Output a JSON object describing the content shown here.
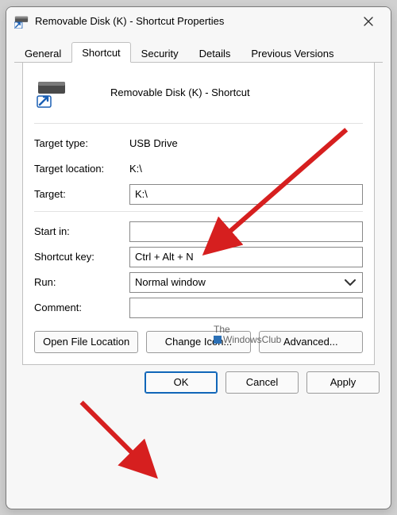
{
  "window": {
    "title": "Removable Disk (K) - Shortcut Properties"
  },
  "tabs": [
    {
      "label": "General"
    },
    {
      "label": "Shortcut"
    },
    {
      "label": "Security"
    },
    {
      "label": "Details"
    },
    {
      "label": "Previous Versions"
    }
  ],
  "header": {
    "name": "Removable Disk (K) - Shortcut"
  },
  "fields": {
    "target_type_label": "Target type:",
    "target_type_value": "USB Drive",
    "target_location_label": "Target location:",
    "target_location_value": "K:\\",
    "target_label": "Target:",
    "target_value": "K:\\",
    "start_in_label": "Start in:",
    "start_in_value": "",
    "shortcut_key_label": "Shortcut key:",
    "shortcut_key_value": "Ctrl + Alt + N",
    "run_label": "Run:",
    "run_value": "Normal window",
    "comment_label": "Comment:",
    "comment_value": ""
  },
  "actions": {
    "open_file_location": "Open File Location",
    "change_icon": "Change Icon...",
    "advanced": "Advanced..."
  },
  "dialog_buttons": {
    "ok": "OK",
    "cancel": "Cancel",
    "apply": "Apply"
  },
  "watermark": {
    "line1": "The",
    "line2": "WindowsClub"
  }
}
